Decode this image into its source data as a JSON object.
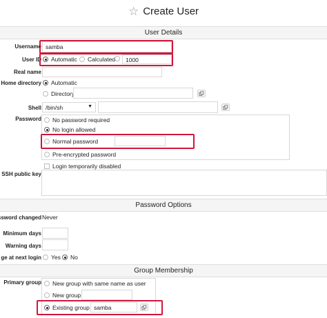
{
  "page": {
    "title": "Create User"
  },
  "sections": {
    "user_details": "User Details",
    "password_options": "Password Options",
    "group_membership": "Group Membership"
  },
  "fields": {
    "username": {
      "label": "Username",
      "value": "samba"
    },
    "userid": {
      "label": "User ID",
      "automatic": "Automatic",
      "calculated": "Calculated",
      "value": "1000"
    },
    "realname": {
      "label": "Real name"
    },
    "homedir": {
      "label": "Home directory",
      "automatic": "Automatic",
      "directory": "Directory"
    },
    "shell": {
      "label": "Shell",
      "value": "/bin/sh"
    },
    "password": {
      "label": "Password",
      "options": [
        "No password required",
        "No login allowed",
        "Normal password",
        "Pre-encrypted password"
      ],
      "login_disabled": "Login temporarily disabled"
    },
    "ssh": {
      "label": "SSH public key"
    }
  },
  "password_options": {
    "changed_label": "assword changed",
    "changed_value": "Never",
    "min_days_label": "Minimum days",
    "warn_days_label": "Warning days",
    "next_login_label": "ge at next login",
    "yes": "Yes",
    "no": "No"
  },
  "group": {
    "primary_label": "Primary group",
    "new_same": "New group with same name as user",
    "new_group": "New group",
    "existing": "Existing group",
    "existing_value": "samba"
  },
  "icons": {
    "title": "star-icon",
    "copy": "copy-icon",
    "dropdown": "chevron-down-icon"
  },
  "colors": {
    "highlight": "#d0163b",
    "section_bg": "#f5f5f5"
  }
}
